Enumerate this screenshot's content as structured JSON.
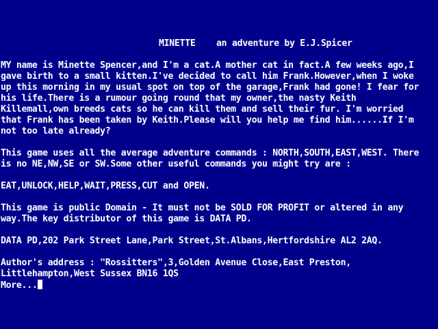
{
  "title": {
    "name": "MINETTE",
    "subtitle": "an adventure by E.J.Spicer"
  },
  "story": [
    "MY name is Minette Spencer,and I'm a cat.A mother cat in fact.A few weeks ago,I",
    "gave birth to a small kitten.I've decided to call him Frank.However,when I woke",
    "up this morning in my usual spot on top of the garage,Frank had gone! I fear for",
    "his life.There is a rumour going round that my owner,the nasty Keith",
    "Killemall,own breeds cats so he can kill them and sell their fur. I'm worried",
    "that Frank has been taken by Keith.Please will you help me find him......If I'm",
    "not too late already?"
  ],
  "commands": [
    "This game uses all the average adventure commands : NORTH,SOUTH,EAST,WEST. There",
    "is no NE,NW,SE or SW.Some other useful commands you might try are :"
  ],
  "command_list": "EAT,UNLOCK,HELP,WAIT,PRESS,CUT and OPEN.",
  "license": [
    "This game is public Domain - It must not be SOLD FOR PROFIT or altered in any",
    "way.The key distributor of this game is DATA PD."
  ],
  "distributor_address": "DATA PD,202 Park Street Lane,Park Street,St.Albans,Hertfordshire AL2 2AQ.",
  "author_address": [
    "Author's address : \"Rossitters\",3,Golden Avenue Close,East Preston,",
    "Littlehampton,West Sussex BN16 1QS"
  ],
  "prompt": "More...",
  "colors": {
    "background": "#00008b",
    "text": "#ffffff"
  }
}
